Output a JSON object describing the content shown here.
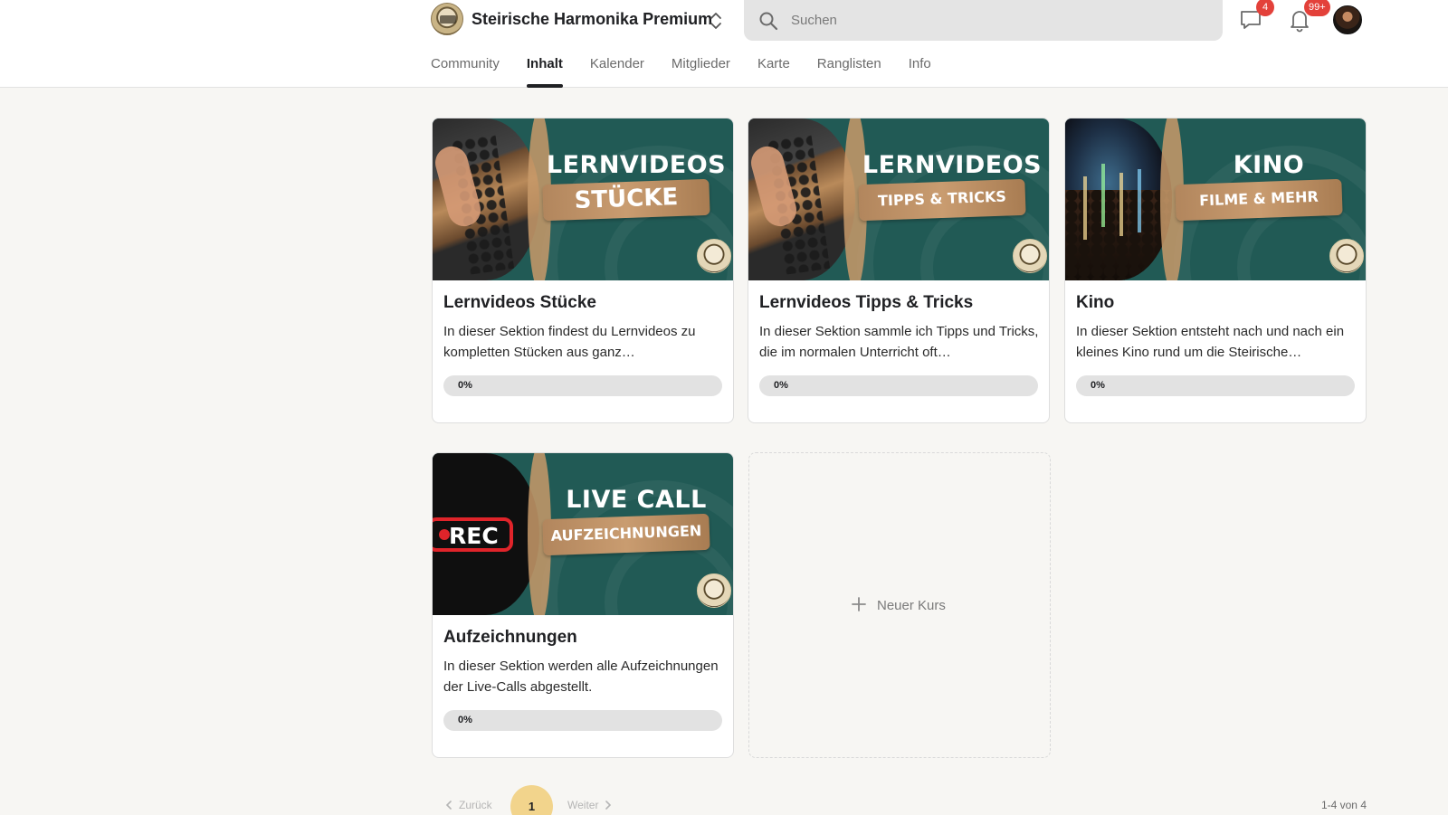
{
  "header": {
    "group_name": "Steirische Harmonika Premium",
    "search_placeholder": "Suchen",
    "chat_badge": "4",
    "notification_badge": "99+"
  },
  "tabs": [
    {
      "label": "Community",
      "active": false
    },
    {
      "label": "Inhalt",
      "active": true
    },
    {
      "label": "Kalender",
      "active": false
    },
    {
      "label": "Mitglieder",
      "active": false
    },
    {
      "label": "Karte",
      "active": false
    },
    {
      "label": "Ranglisten",
      "active": false
    },
    {
      "label": "Info",
      "active": false
    }
  ],
  "courses": [
    {
      "cover_title": "LERNVIDEOS",
      "cover_pill": "STÜCKE",
      "title": "Lernvideos Stücke",
      "description": "In dieser Sektion findest du Lernvideos zu kompletten Stücken aus ganz…",
      "progress_label": "0%",
      "progress": 0
    },
    {
      "cover_title": "LERNVIDEOS",
      "cover_pill": "TIPPS & TRICKS",
      "title": "Lernvideos Tipps & Tricks",
      "description": "In dieser Sektion sammle ich Tipps und Tricks, die im normalen Unterricht oft…",
      "progress_label": "0%",
      "progress": 0
    },
    {
      "cover_title": "KINO",
      "cover_pill": "FILME & MEHR",
      "title": "Kino",
      "description": "In dieser Sektion entsteht nach und nach ein kleines Kino rund um die Steirische…",
      "progress_label": "0%",
      "progress": 0
    },
    {
      "cover_title": "LIVE CALL",
      "cover_pill": "AUFZEICHNUNGEN",
      "cover_badge": "REC",
      "title": "Aufzeichnungen",
      "description": "In dieser Sektion werden alle Aufzeichnungen der Live-Calls abgestellt.",
      "progress_label": "0%",
      "progress": 0
    }
  ],
  "new_course": {
    "label": "Neuer Kurs"
  },
  "pagination": {
    "prev_label": "Zurück",
    "current_page": "1",
    "next_label": "Weiter",
    "range_text": "1-4 von 4"
  },
  "colors": {
    "accent": "#f2d48c",
    "badge": "#e3413a",
    "cover_green": "#215a55",
    "background": "#f7f6f3"
  }
}
